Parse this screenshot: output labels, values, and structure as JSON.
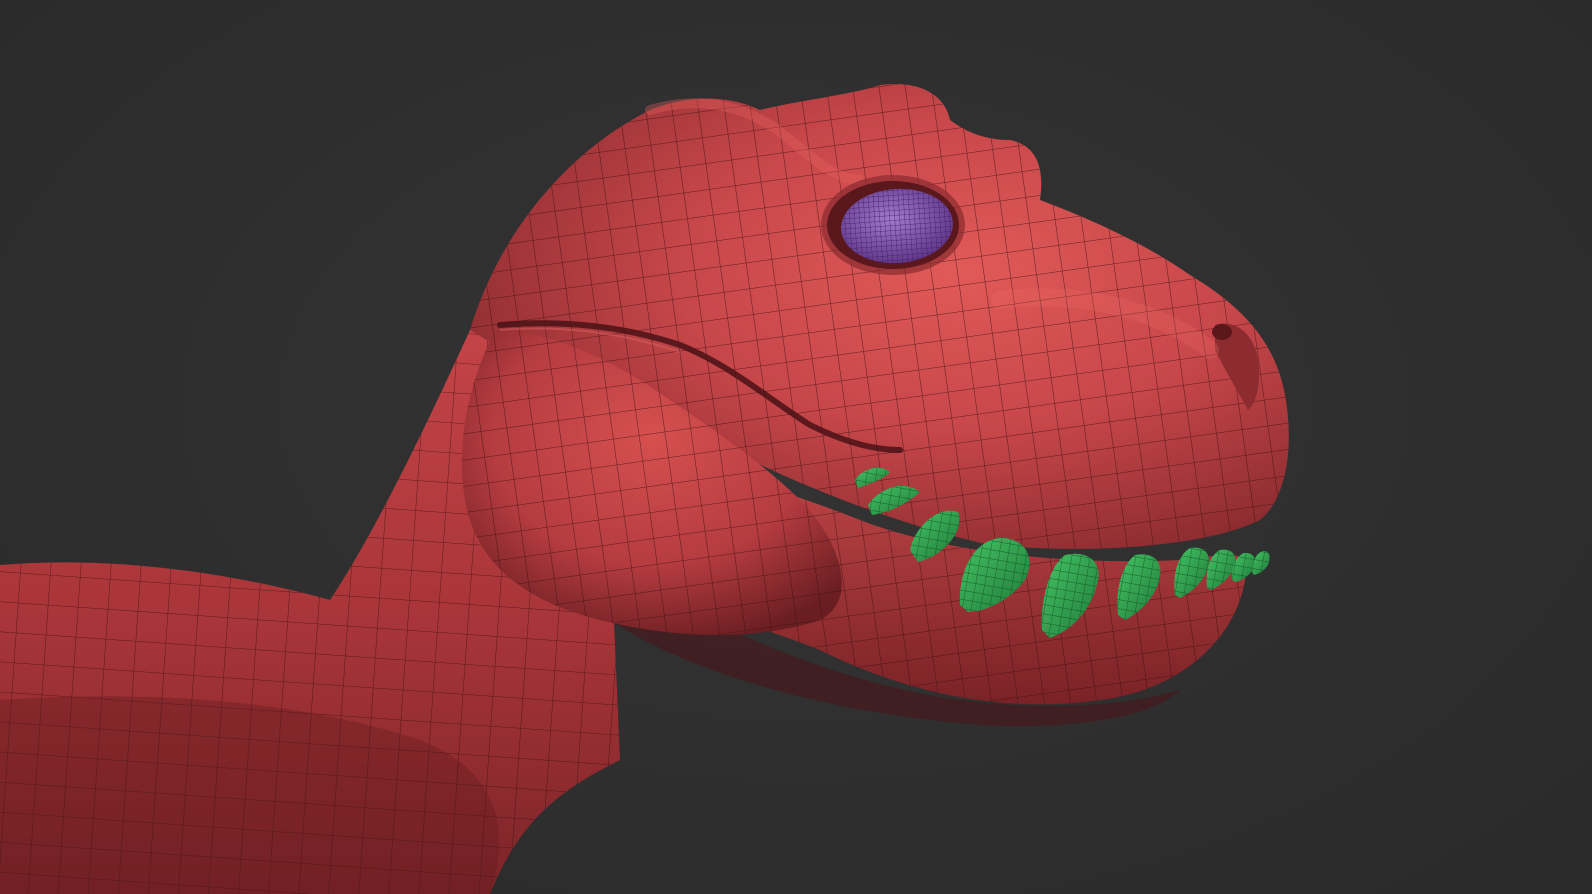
{
  "scene": {
    "background_color": "#2f2f2f",
    "model_subject": "dinosaur-head",
    "colors": {
      "body": "#c8474a",
      "body_highlight": "#e05a58",
      "body_shadow": "#6e1f22",
      "wire": "#3a0f12",
      "teeth": "#2fa84f",
      "teeth_shadow": "#16672c",
      "eye": "#7b49a8",
      "eye_highlight": "#a47ad0"
    },
    "icons": {
      "eye": "eye-icon",
      "teeth": "teeth-icon"
    }
  }
}
